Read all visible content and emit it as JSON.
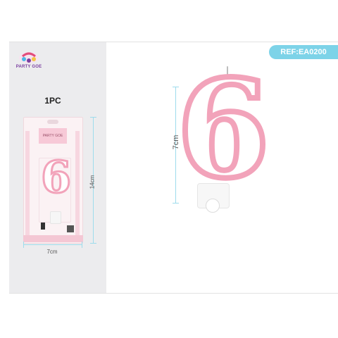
{
  "brand": {
    "logo_text": "PARTY GOE",
    "icon_name": "party-goe-logo-icon"
  },
  "ref": {
    "label": "REF:EA0200",
    "color": "#7dd3e8"
  },
  "product": {
    "quantity": "1PC",
    "digit": "6",
    "package_tag": "PARTY GOE",
    "height_label": "14cm",
    "width_label": "7cm",
    "candle_height_label": "7cm",
    "accent_color": "#f2a3ba"
  }
}
